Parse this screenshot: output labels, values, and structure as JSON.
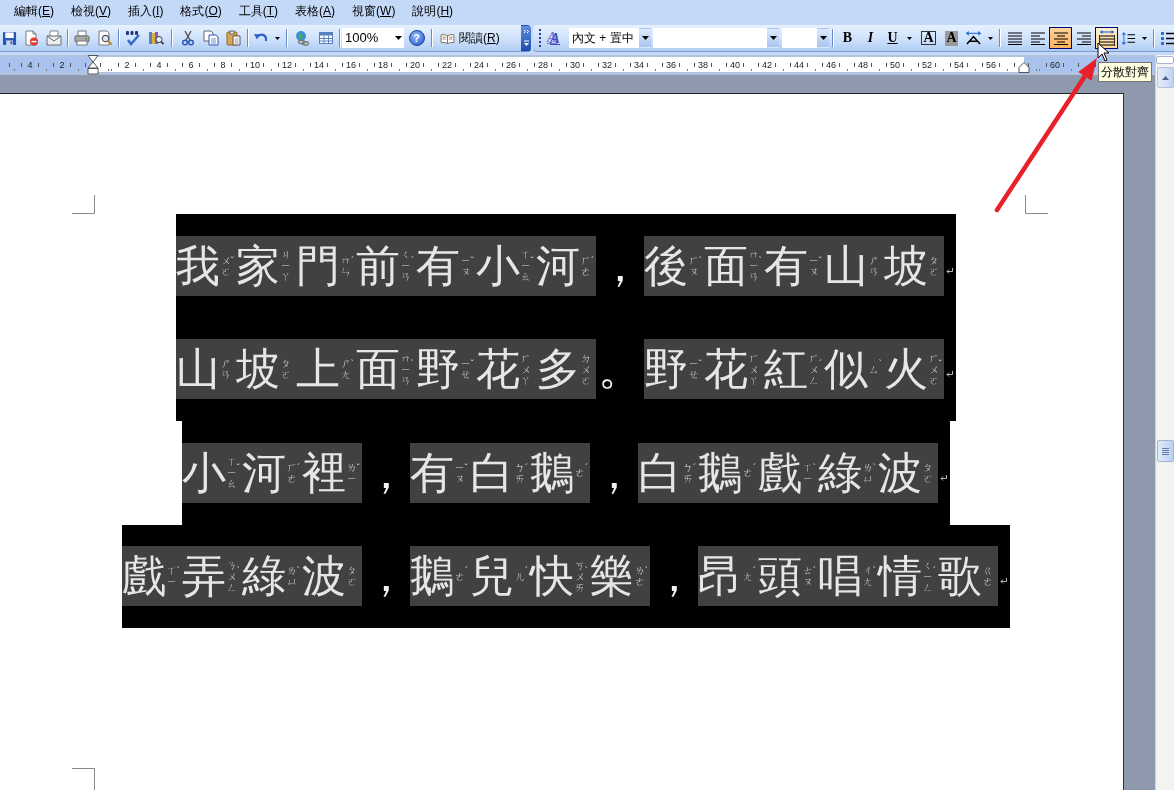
{
  "menu_bar": {
    "items": [
      {
        "label": "編輯(",
        "access_key": "E",
        "label_end": ")"
      },
      {
        "label": "檢視(",
        "access_key": "V",
        "label_end": ")"
      },
      {
        "label": "插入(",
        "access_key": "I",
        "label_end": ")"
      },
      {
        "label": "格式(",
        "access_key": "O",
        "label_end": ")"
      },
      {
        "label": "工具(",
        "access_key": "T",
        "label_end": ")"
      },
      {
        "label": "表格(",
        "access_key": "A",
        "label_end": ")"
      },
      {
        "label": "視窗(",
        "access_key": "W",
        "label_end": ")"
      },
      {
        "label": "說明(",
        "access_key": "H",
        "label_end": ")"
      }
    ]
  },
  "standard_toolbar": {
    "zoom_box": {
      "value": "100%"
    },
    "help_button": {
      "label": "?"
    },
    "read_button": {
      "label": "閱讀(",
      "access_key": "R",
      "label_end": ")"
    }
  },
  "formatting_toolbar": {
    "styles_button": {
      "label": "A"
    },
    "style_box": {
      "value": "內文 + 置中"
    },
    "text_style_buttons": [
      {
        "kind": "bold",
        "label": "B"
      },
      {
        "kind": "italic",
        "label": "I"
      },
      {
        "kind": "underline",
        "label": "U"
      }
    ],
    "character_buttons": [
      {
        "kind": "border",
        "label": "A"
      },
      {
        "kind": "shading",
        "label": "A"
      }
    ],
    "alignment_buttons": [
      {
        "kind": "justify",
        "selected": false,
        "hovered": false
      },
      {
        "kind": "left",
        "selected": false,
        "hovered": false
      },
      {
        "kind": "center",
        "selected": true,
        "hovered": false
      },
      {
        "kind": "right",
        "selected": false,
        "hovered": false
      },
      {
        "kind": "distributed",
        "selected": false,
        "hovered": true
      }
    ]
  },
  "ruler": {
    "left_margin_numbers": [
      "4",
      "2"
    ],
    "numbers": [
      "2",
      "4",
      "6",
      "8",
      "10",
      "12",
      "14",
      "16",
      "18",
      "20",
      "22",
      "24",
      "26",
      "28",
      "30",
      "32",
      "34",
      "36",
      "38",
      "40",
      "42",
      "44",
      "46",
      "48",
      "50",
      "52",
      "54",
      "56"
    ],
    "right_margin_numbers": [
      "60"
    ]
  },
  "tooltip": {
    "text": "分散對齊"
  },
  "document": {
    "paragraph": {
      "selected": true,
      "lines": [
        {
          "runs": [
            {
              "kind": "phonetic",
              "characters": [
                {
                  "char": "我",
                  "zhuyin": "ㄨㄛ",
                  "tone": "ˇ"
                },
                {
                  "char": "家",
                  "zhuyin": "ㄐㄧㄚ"
                },
                {
                  "char": "門",
                  "zhuyin": "ㄇㄣ",
                  "tone": "ˊ"
                },
                {
                  "char": "前",
                  "zhuyin": "ㄑㄧㄢ",
                  "tone": "ˊ"
                },
                {
                  "char": "有",
                  "zhuyin": "ㄧㄡ",
                  "tone": "ˇ"
                },
                {
                  "char": "小",
                  "zhuyin": "ㄒㄧㄠ",
                  "tone": "ˇ"
                },
                {
                  "char": "河",
                  "zhuyin": "ㄏㄜ",
                  "tone": "ˊ"
                }
              ]
            },
            {
              "kind": "punctuation",
              "text": "，"
            },
            {
              "kind": "phonetic",
              "characters": [
                {
                  "char": "後",
                  "zhuyin": "ㄏㄡ",
                  "tone": "ˋ"
                },
                {
                  "char": "面",
                  "zhuyin": "ㄇㄧㄢ",
                  "tone": "ˋ"
                },
                {
                  "char": "有",
                  "zhuyin": "ㄧㄡ",
                  "tone": "ˇ"
                },
                {
                  "char": "山",
                  "zhuyin": "ㄕㄢ"
                },
                {
                  "char": "坡",
                  "zhuyin": "ㄆㄛ"
                }
              ]
            }
          ]
        },
        {
          "runs": [
            {
              "kind": "phonetic",
              "characters": [
                {
                  "char": "山",
                  "zhuyin": "ㄕㄢ"
                },
                {
                  "char": "坡",
                  "zhuyin": "ㄆㄛ"
                },
                {
                  "char": "上",
                  "zhuyin": "ㄕㄤ",
                  "tone": "ˋ"
                },
                {
                  "char": "面",
                  "zhuyin": "ㄇㄧㄢ",
                  "tone": "ˋ"
                },
                {
                  "char": "野",
                  "zhuyin": "ㄧㄝ",
                  "tone": "ˇ"
                },
                {
                  "char": "花",
                  "zhuyin": "ㄏㄨㄚ"
                },
                {
                  "char": "多",
                  "zhuyin": "ㄉㄨㄛ"
                }
              ]
            },
            {
              "kind": "punctuation",
              "text": "。"
            },
            {
              "kind": "phonetic",
              "characters": [
                {
                  "char": "野",
                  "zhuyin": "ㄧㄝ",
                  "tone": "ˇ"
                },
                {
                  "char": "花",
                  "zhuyin": "ㄏㄨㄚ"
                },
                {
                  "char": "紅",
                  "zhuyin": "ㄏㄨㄥ",
                  "tone": "ˊ"
                },
                {
                  "char": "似",
                  "zhuyin": "ㄙ",
                  "tone": "ˋ"
                },
                {
                  "char": "火",
                  "zhuyin": "ㄏㄨㄛ",
                  "tone": "ˇ"
                }
              ]
            }
          ]
        },
        {
          "runs": [
            {
              "kind": "phonetic",
              "characters": [
                {
                  "char": "小",
                  "zhuyin": "ㄒㄧㄠ",
                  "tone": "ˇ"
                },
                {
                  "char": "河",
                  "zhuyin": "ㄏㄜ",
                  "tone": "ˊ"
                },
                {
                  "char": "裡",
                  "zhuyin": "ㄌㄧ",
                  "tone": "ˇ"
                }
              ]
            },
            {
              "kind": "punctuation",
              "text": "，"
            },
            {
              "kind": "phonetic",
              "characters": [
                {
                  "char": "有",
                  "zhuyin": "ㄧㄡ",
                  "tone": "ˇ"
                },
                {
                  "char": "白",
                  "zhuyin": "ㄅㄞ",
                  "tone": "ˊ"
                },
                {
                  "char": "鵝",
                  "zhuyin": "ㄜ",
                  "tone": "ˊ"
                }
              ]
            },
            {
              "kind": "punctuation",
              "text": "，"
            },
            {
              "kind": "phonetic",
              "characters": [
                {
                  "char": "白",
                  "zhuyin": "ㄅㄞ",
                  "tone": "ˊ"
                },
                {
                  "char": "鵝",
                  "zhuyin": "ㄜ",
                  "tone": "ˊ"
                },
                {
                  "char": "戲",
                  "zhuyin": "ㄒㄧ",
                  "tone": "ˋ"
                },
                {
                  "char": "綠",
                  "zhuyin": "ㄌㄩ",
                  "tone": "ˋ"
                },
                {
                  "char": "波",
                  "zhuyin": "ㄆㄛ"
                }
              ]
            }
          ]
        },
        {
          "runs": [
            {
              "kind": "phonetic",
              "characters": [
                {
                  "char": "戲",
                  "zhuyin": "ㄒㄧ",
                  "tone": "ˋ"
                },
                {
                  "char": "弄",
                  "zhuyin": "ㄋㄨㄥ",
                  "tone": "ˋ"
                },
                {
                  "char": "綠",
                  "zhuyin": "ㄌㄩ",
                  "tone": "ˋ"
                },
                {
                  "char": "波",
                  "zhuyin": "ㄆㄛ"
                }
              ]
            },
            {
              "kind": "punctuation",
              "text": "，"
            },
            {
              "kind": "phonetic",
              "characters": [
                {
                  "char": "鵝",
                  "zhuyin": "ㄜ",
                  "tone": "ˊ"
                },
                {
                  "char": "兒",
                  "zhuyin": "ㄦ",
                  "tone": "ˊ"
                },
                {
                  "char": "快",
                  "zhuyin": "ㄎㄨㄞ",
                  "tone": "ˋ"
                },
                {
                  "char": "樂",
                  "zhuyin": "ㄌㄜ",
                  "tone": "ˋ"
                }
              ]
            },
            {
              "kind": "punctuation",
              "text": "，"
            },
            {
              "kind": "phonetic",
              "characters": [
                {
                  "char": "昂",
                  "zhuyin": "ㄤ",
                  "tone": "ˊ"
                },
                {
                  "char": "頭",
                  "zhuyin": "ㄊㄡ",
                  "tone": "ˊ"
                },
                {
                  "char": "唱",
                  "zhuyin": "ㄔㄤ",
                  "tone": "ˋ"
                },
                {
                  "char": "情",
                  "zhuyin": "ㄑㄧㄥ",
                  "tone": "ˊ"
                },
                {
                  "char": "歌",
                  "zhuyin": "ㄍㄜ"
                }
              ]
            }
          ]
        }
      ]
    }
  }
}
